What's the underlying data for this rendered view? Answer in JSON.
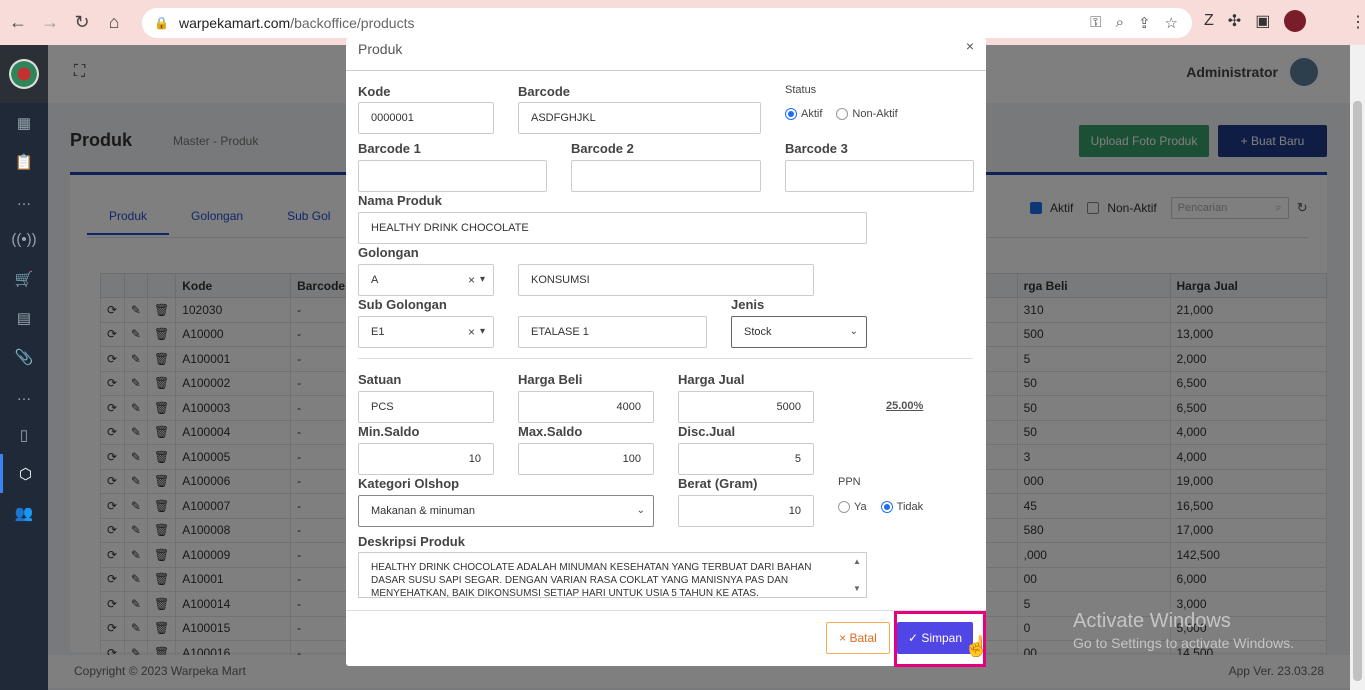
{
  "browser": {
    "url_host": "warpekamart.com",
    "url_path": "/backoffice/products"
  },
  "header": {
    "admin_name": "Administrator"
  },
  "page": {
    "title": "Produk",
    "breadcrumb": "Master  -  Produk",
    "upload_label": "Upload Foto Produk",
    "new_label": "+ Buat Baru"
  },
  "tabs": [
    "Produk",
    "Golongan",
    "Sub Gol"
  ],
  "filter": {
    "aktif_label": "Aktif",
    "nonaktif_label": "Non-Aktif",
    "search_placeholder": "Pencarian"
  },
  "table": {
    "headers": {
      "kode": "Kode",
      "barcode": "Barcode",
      "harga_beli": "rga Beli",
      "harga_jual": "Harga Jual"
    },
    "rows": [
      {
        "kode": "102030",
        "barcode": "-",
        "beli": "310",
        "jual": "21,000"
      },
      {
        "kode": "A10000",
        "barcode": "-",
        "beli": "500",
        "jual": "13,000"
      },
      {
        "kode": "A100001",
        "barcode": "-",
        "beli": "5",
        "jual": "2,000"
      },
      {
        "kode": "A100002",
        "barcode": "-",
        "beli": "50",
        "jual": "6,500"
      },
      {
        "kode": "A100003",
        "barcode": "-",
        "beli": "50",
        "jual": "6,500"
      },
      {
        "kode": "A100004",
        "barcode": "-",
        "beli": "50",
        "jual": "4,000"
      },
      {
        "kode": "A100005",
        "barcode": "-",
        "beli": "3",
        "jual": "4,000"
      },
      {
        "kode": "A100006",
        "barcode": "-",
        "beli": "000",
        "jual": "19,000"
      },
      {
        "kode": "A100007",
        "barcode": "-",
        "beli": "45",
        "jual": "16,500"
      },
      {
        "kode": "A100008",
        "barcode": "-",
        "beli": "580",
        "jual": "17,000"
      },
      {
        "kode": "A100009",
        "barcode": "-",
        "beli": ",000",
        "jual": "142,500"
      },
      {
        "kode": "A10001",
        "barcode": "-",
        "beli": "00",
        "jual": "6,000"
      },
      {
        "kode": "A100014",
        "barcode": "-",
        "beli": "5",
        "jual": "3,000"
      },
      {
        "kode": "A100015",
        "barcode": "-",
        "beli": "0",
        "jual": "5,000"
      },
      {
        "kode": "A100016",
        "barcode": "-",
        "beli": "00",
        "jual": "14,500"
      }
    ]
  },
  "footer": {
    "copyright": "Copyright © 2023 Warpeka Mart",
    "version": "App Ver. 23.03.28"
  },
  "modal": {
    "title": "Produk",
    "kode_label": "Kode",
    "kode_value": "0000001",
    "barcode_label": "Barcode",
    "barcode_value": "ASDFGHJKL",
    "status_label": "Status",
    "status_aktif": "Aktif",
    "status_nonaktif": "Non-Aktif",
    "barcode1_label": "Barcode 1",
    "barcode2_label": "Barcode 2",
    "barcode3_label": "Barcode 3",
    "nama_label": "Nama Produk",
    "nama_value": "HEALTHY DRINK CHOCOLATE",
    "golongan_label": "Golongan",
    "golongan_code": "A",
    "golongan_name": "KONSUMSI",
    "subgol_label": "Sub Golongan",
    "subgol_code": "E1",
    "subgol_name": "ETALASE 1",
    "jenis_label": "Jenis",
    "jenis_value": "Stock",
    "satuan_label": "Satuan",
    "satuan_value": "PCS",
    "hbeli_label": "Harga Beli",
    "hbeli_value": "4000",
    "hjual_label": "Harga Jual",
    "hjual_value": "5000",
    "margin": "25.00%",
    "minsaldo_label": "Min.Saldo",
    "minsaldo_value": "10",
    "maxsaldo_label": "Max.Saldo",
    "maxsaldo_value": "100",
    "disc_label": "Disc.Jual",
    "disc_value": "5",
    "kategori_label": "Kategori Olshop",
    "kategori_value": "Makanan & minuman",
    "berat_label": "Berat (Gram)",
    "berat_value": "10",
    "ppn_label": "PPN",
    "ppn_ya": "Ya",
    "ppn_tidak": "Tidak",
    "deskripsi_label": "Deskripsi Produk",
    "deskripsi_value": "HEALTHY DRINK CHOCOLATE ADALAH MINUMAN KESEHATAN YANG TERBUAT DARI BAHAN DASAR SUSU SAPI SEGAR. DENGAN VARIAN RASA COKLAT YANG MANISNYA PAS DAN MENYEHATKAN, BAIK DIKONSUMSI SETIAP HARI UNTUK USIA 5 TAHUN KE ATAS.",
    "batal_label": "× Batal",
    "simpan_label": "✓ Simpan"
  },
  "watermark": {
    "line1": "Activate Windows",
    "line2": "Go to Settings to activate Windows."
  },
  "colors": {
    "primary": "#4f46e5",
    "success": "#38a169",
    "highlight": "#e6007e",
    "navy": "#1e3a8a"
  }
}
